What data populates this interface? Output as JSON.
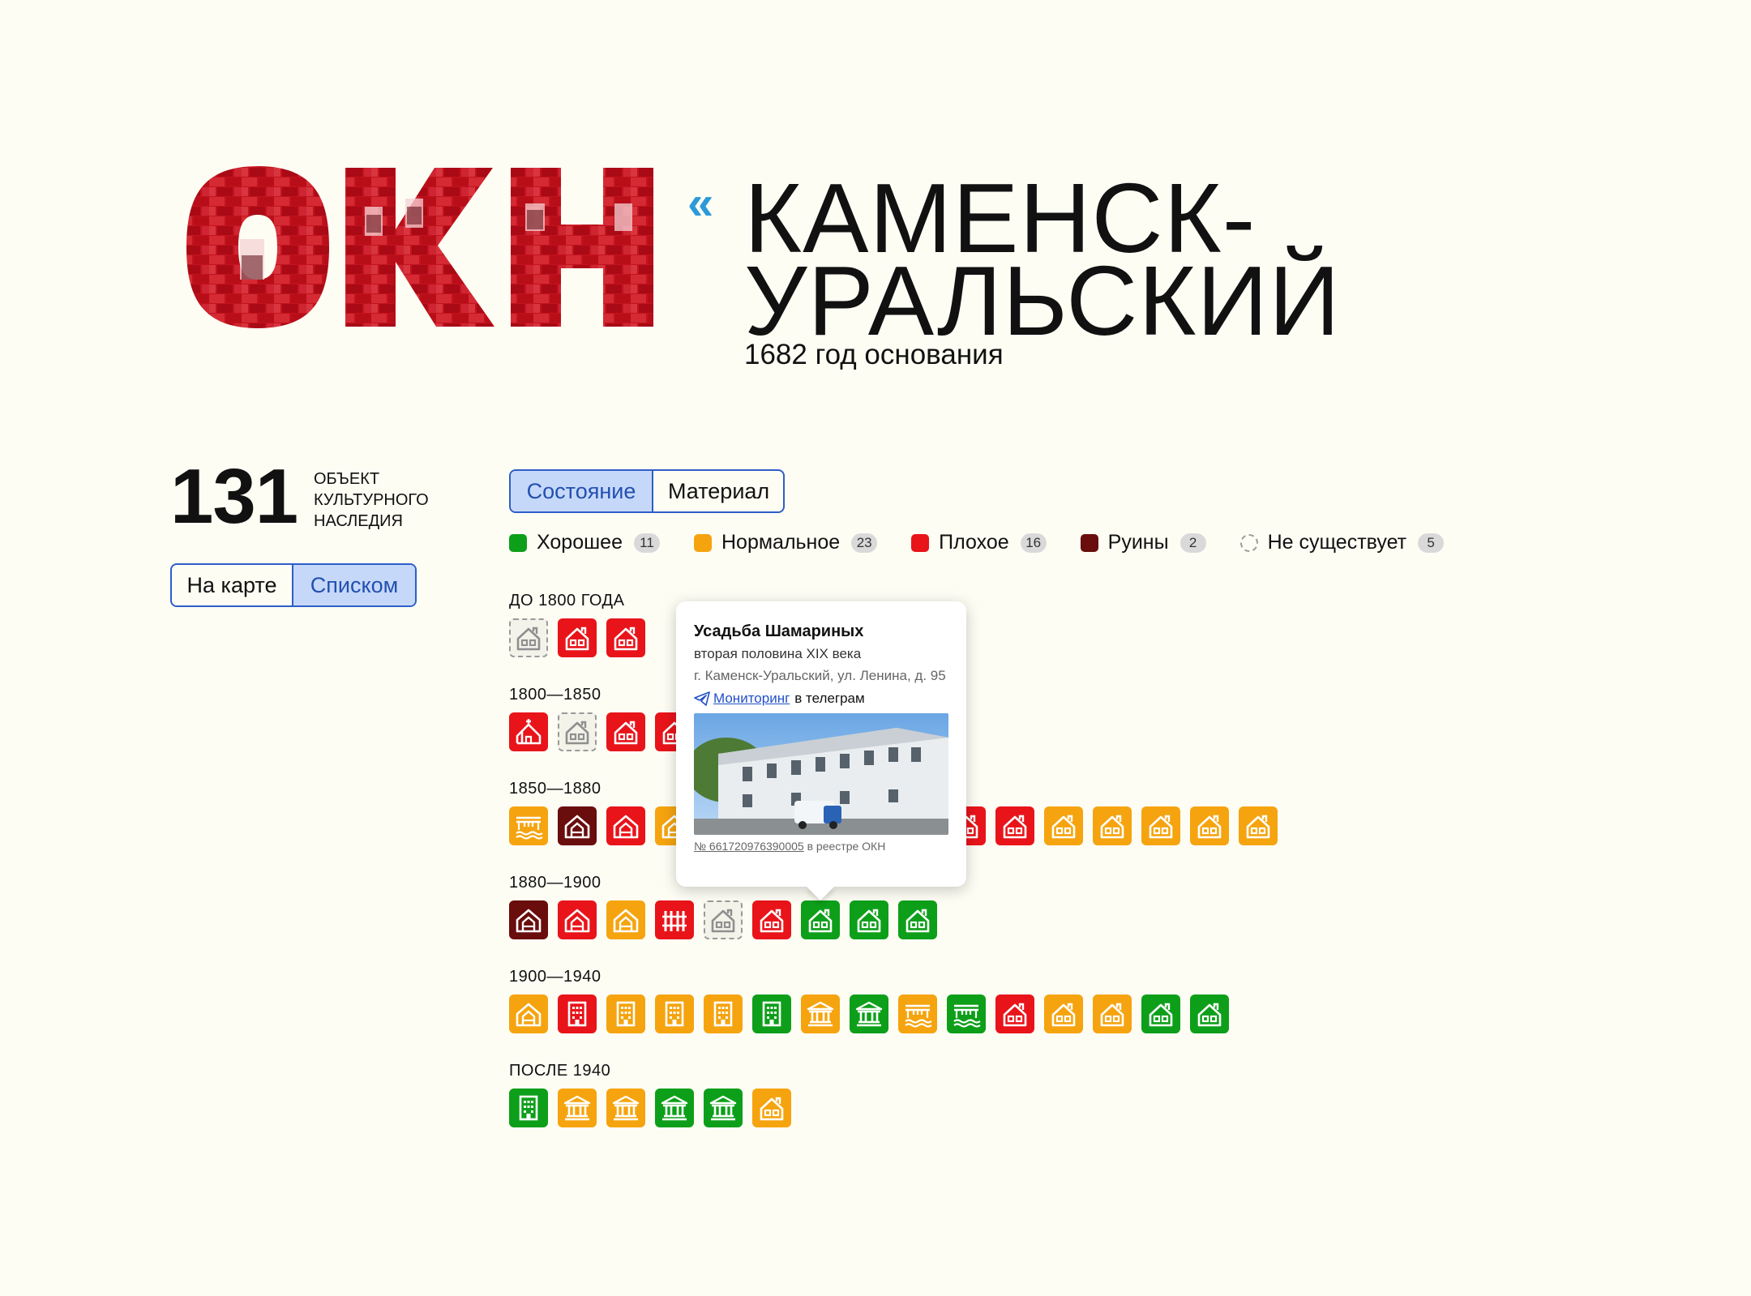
{
  "header": {
    "logo_text": "ОКН",
    "back_icon": "chevron-double-left",
    "city": "КАМЕНСК-\nУРАЛЬСКИЙ",
    "founded": "1682 год основания"
  },
  "stats": {
    "count": "131",
    "label": "ОБЪЕКТ\nКУЛЬТУРНОГО\nНАСЛЕДИЯ"
  },
  "view_toggle": {
    "map": "На карте",
    "list": "Списком",
    "active": "list"
  },
  "mode_toggle": {
    "state": "Состояние",
    "material": "Материал",
    "active": "state"
  },
  "colors": {
    "good": "#0e9f1a",
    "normal": "#f5a40f",
    "bad": "#e8141a",
    "ruins": "#6a0d0d",
    "none_border": "#9a9a9a",
    "accent": "#2f5ec9"
  },
  "legend": [
    {
      "key": "good",
      "label": "Хорошее",
      "count": "11"
    },
    {
      "key": "normal",
      "label": "Нормальное",
      "count": "23"
    },
    {
      "key": "bad",
      "label": "Плохое",
      "count": "16"
    },
    {
      "key": "ruins",
      "label": "Руины",
      "count": "2"
    },
    {
      "key": "none",
      "label": "Не существует",
      "count": "5"
    }
  ],
  "periods": [
    {
      "label": "ДО 1800 ГОДА",
      "items": [
        {
          "s": "none",
          "i": "house"
        },
        {
          "s": "bad",
          "i": "house"
        },
        {
          "s": "bad",
          "i": "house"
        }
      ]
    },
    {
      "label": "1800—1850",
      "items": [
        {
          "s": "bad",
          "i": "church"
        },
        {
          "s": "none",
          "i": "house"
        },
        {
          "s": "bad",
          "i": "house"
        },
        {
          "s": "bad",
          "i": "house"
        }
      ]
    },
    {
      "label": "1850—1880",
      "items": [
        {
          "s": "normal",
          "i": "bridge"
        },
        {
          "s": "ruins",
          "i": "barn"
        },
        {
          "s": "bad",
          "i": "barn"
        },
        {
          "s": "normal",
          "i": "barn"
        },
        {
          "s": "normal",
          "i": "house"
        },
        {
          "s": "normal",
          "i": "house"
        },
        {
          "s": "normal",
          "i": "house"
        },
        {
          "s": "normal",
          "i": "house"
        },
        {
          "s": "normal",
          "i": "house"
        },
        {
          "s": "bad",
          "i": "house"
        },
        {
          "s": "bad",
          "i": "house"
        },
        {
          "s": "normal",
          "i": "house"
        },
        {
          "s": "normal",
          "i": "house"
        },
        {
          "s": "normal",
          "i": "house"
        },
        {
          "s": "normal",
          "i": "house"
        },
        {
          "s": "normal",
          "i": "house"
        }
      ]
    },
    {
      "label": "1880—1900",
      "items": [
        {
          "s": "ruins",
          "i": "barn"
        },
        {
          "s": "bad",
          "i": "barn"
        },
        {
          "s": "normal",
          "i": "barn"
        },
        {
          "s": "bad",
          "i": "fence"
        },
        {
          "s": "none",
          "i": "house"
        },
        {
          "s": "bad",
          "i": "house"
        },
        {
          "s": "good",
          "i": "house"
        },
        {
          "s": "good",
          "i": "house"
        },
        {
          "s": "good",
          "i": "house"
        }
      ]
    },
    {
      "label": "1900—1940",
      "items": [
        {
          "s": "normal",
          "i": "barn"
        },
        {
          "s": "bad",
          "i": "tower"
        },
        {
          "s": "normal",
          "i": "tower"
        },
        {
          "s": "normal",
          "i": "tower"
        },
        {
          "s": "normal",
          "i": "tower"
        },
        {
          "s": "good",
          "i": "tower"
        },
        {
          "s": "normal",
          "i": "temple"
        },
        {
          "s": "good",
          "i": "temple"
        },
        {
          "s": "normal",
          "i": "bridge"
        },
        {
          "s": "good",
          "i": "bridge"
        },
        {
          "s": "bad",
          "i": "house"
        },
        {
          "s": "normal",
          "i": "house"
        },
        {
          "s": "normal",
          "i": "house"
        },
        {
          "s": "good",
          "i": "house"
        },
        {
          "s": "good",
          "i": "house"
        }
      ]
    },
    {
      "label": "ПОСЛЕ 1940",
      "items": [
        {
          "s": "good",
          "i": "tower"
        },
        {
          "s": "normal",
          "i": "temple"
        },
        {
          "s": "normal",
          "i": "temple"
        },
        {
          "s": "good",
          "i": "temple"
        },
        {
          "s": "good",
          "i": "temple"
        },
        {
          "s": "normal",
          "i": "house"
        }
      ]
    }
  ],
  "tooltip": {
    "title": "Усадьба Шамариных",
    "period": "вторая половина XIX века",
    "address": "г. Каменск-Уральский, ул. Ленина, д. 95",
    "monitor_link": "Мониторинг",
    "monitor_suffix": "в телеграм",
    "registry_number": "№ 661720976390005",
    "registry_suffix": "в реестре ОКН"
  }
}
